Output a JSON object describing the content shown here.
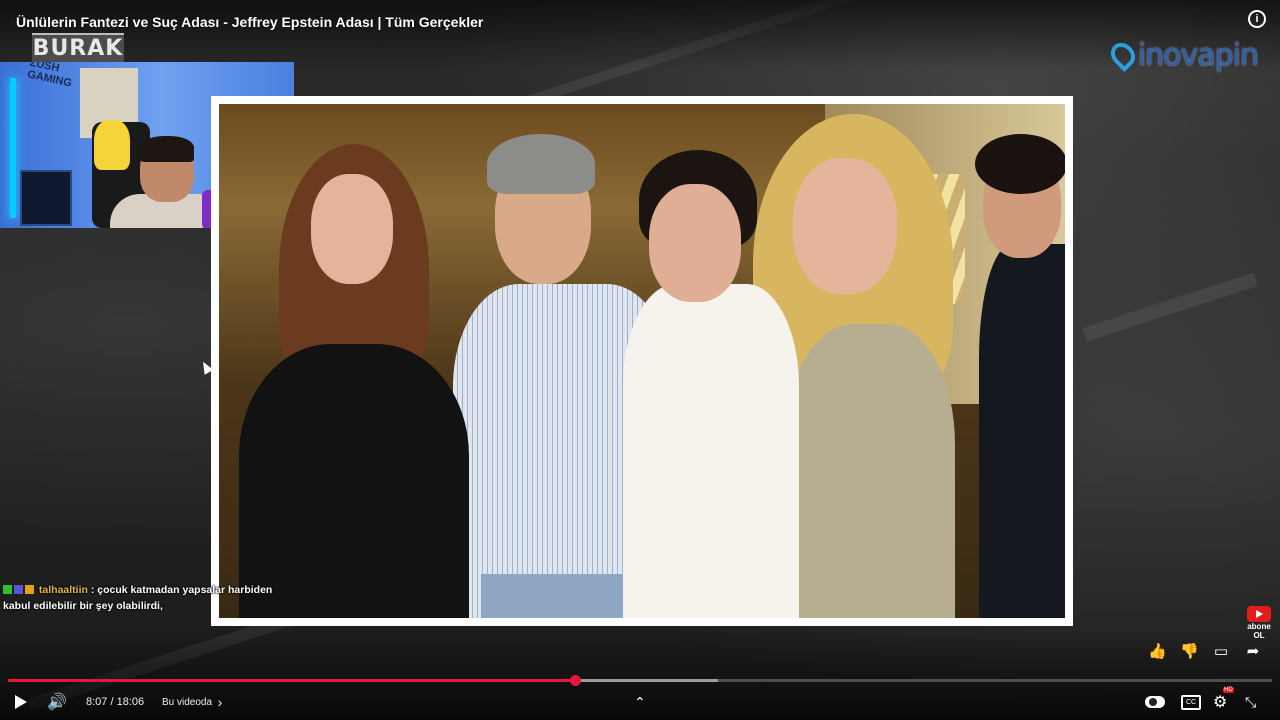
{
  "video": {
    "title": "Ünlülerin Fantezi ve Suç Adası - Jeffrey Epstein Adası | Tüm Gerçekler",
    "channel_logo_text": "BURAK",
    "brand_text": "inovapin",
    "cam_graffiti": "ZUSH GAMING"
  },
  "chat": {
    "username": "talhaaltiin",
    "message_line1": ": çocuk katmadan yapsalar harbiden",
    "message_line2": "kabul edilebilir bir şey olabilirdi,"
  },
  "subscribe": {
    "line1": "abone",
    "line2": "OL"
  },
  "player": {
    "time_current": "8:07",
    "time_separator": " / ",
    "time_total": "18:06",
    "chapter_label": "Bu videoda",
    "chapter_arrow": "›",
    "played_fraction": 0.4484,
    "buffered_fraction": 0.5617,
    "info_glyph": "i",
    "icons": {
      "play": "play-icon",
      "volume": "volume-icon",
      "chevron_up": "chevron-up-icon",
      "autoplay": "autoplay-toggle-icon",
      "captions": "captions-icon",
      "settings": "gear-icon",
      "fullscreen_exit": "exit-fullscreen-icon",
      "like": "thumbs-up-icon",
      "dislike": "thumbs-down-icon",
      "comment": "comment-icon",
      "share": "share-icon"
    },
    "glyphs": {
      "volume": "🔊",
      "chevron_up": "⌃",
      "captions": "CC",
      "settings": "⚙",
      "hd": "HD",
      "fullscreen_exit": "⤡",
      "like": "👍",
      "dislike": "👎",
      "comment": "▭",
      "share": "➦"
    },
    "accent_color": "#e5153c"
  }
}
